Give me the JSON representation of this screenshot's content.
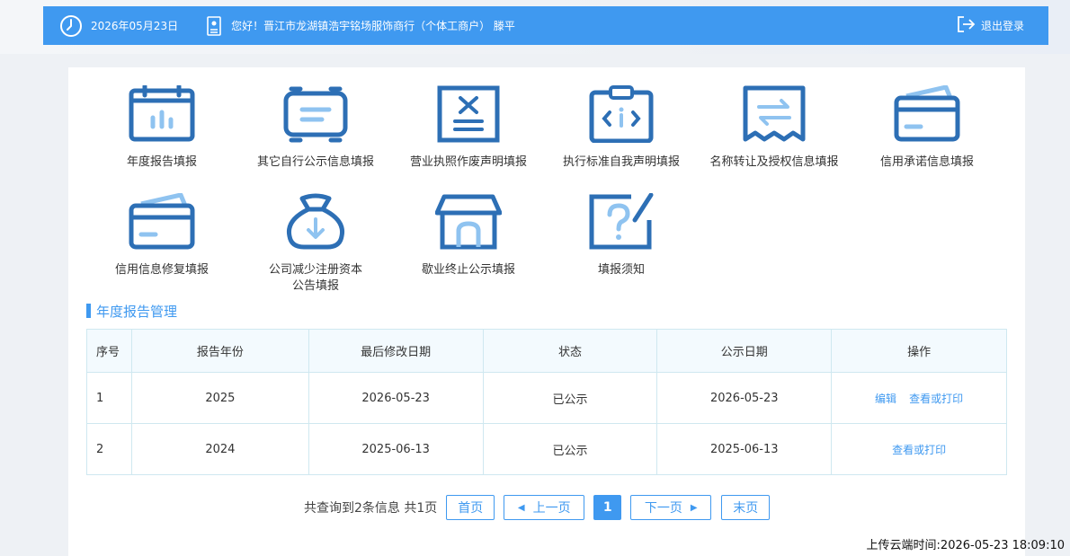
{
  "header": {
    "date": "2026年05月23日",
    "greeting": "您好！晋江市龙湖镇浩宇铭场服饰商行（个体工商户） 滕平",
    "logout_label": "退出登录"
  },
  "menu": {
    "items": [
      {
        "label": "年度报告填报",
        "icon": "calendar-chart-icon"
      },
      {
        "label": "其它自行公示信息填报",
        "icon": "scroll-list-icon"
      },
      {
        "label": "营业执照作废声明填报",
        "icon": "document-cancel-icon"
      },
      {
        "label": "执行标准自我声明填报",
        "icon": "clipboard-info-icon"
      },
      {
        "label": "名称转让及授权信息填报",
        "icon": "transfer-receipt-icon"
      },
      {
        "label": "信用承诺信息填报",
        "icon": "credit-card-icon"
      },
      {
        "label": "信用信息修复填报",
        "icon": "credit-card-repair-icon"
      },
      {
        "label_line1": "公司减少注册资本",
        "label_line2": "公告填报",
        "icon": "money-bag-icon"
      },
      {
        "label": "歇业终止公示填报",
        "icon": "store-closed-icon"
      },
      {
        "label": "填报须知",
        "icon": "question-note-icon"
      }
    ]
  },
  "section": {
    "title": "年度报告管理"
  },
  "table": {
    "headers": [
      "序号",
      "报告年份",
      "最后修改日期",
      "状态",
      "公示日期",
      "操作"
    ],
    "rows": [
      {
        "no": "1",
        "year": "2025",
        "modified": "2026-05-23",
        "status": "已公示",
        "public_date": "2026-05-23",
        "edit": "编辑",
        "view": "查看或打印"
      },
      {
        "no": "2",
        "year": "2024",
        "modified": "2025-06-13",
        "status": "已公示",
        "public_date": "2025-06-13",
        "view": "查看或打印"
      }
    ]
  },
  "pager": {
    "info": "共查询到2条信息 共1页",
    "first": "首页",
    "prev": "上一页",
    "current": "1",
    "next": "下一页",
    "last": "末页"
  },
  "footer": {
    "upload_time": "上传云端时间:2026-05-23 18:09:10"
  },
  "colors": {
    "accent": "#3f99f0",
    "icon": "#2d6fb5",
    "icon_light": "#8fc3f0"
  }
}
